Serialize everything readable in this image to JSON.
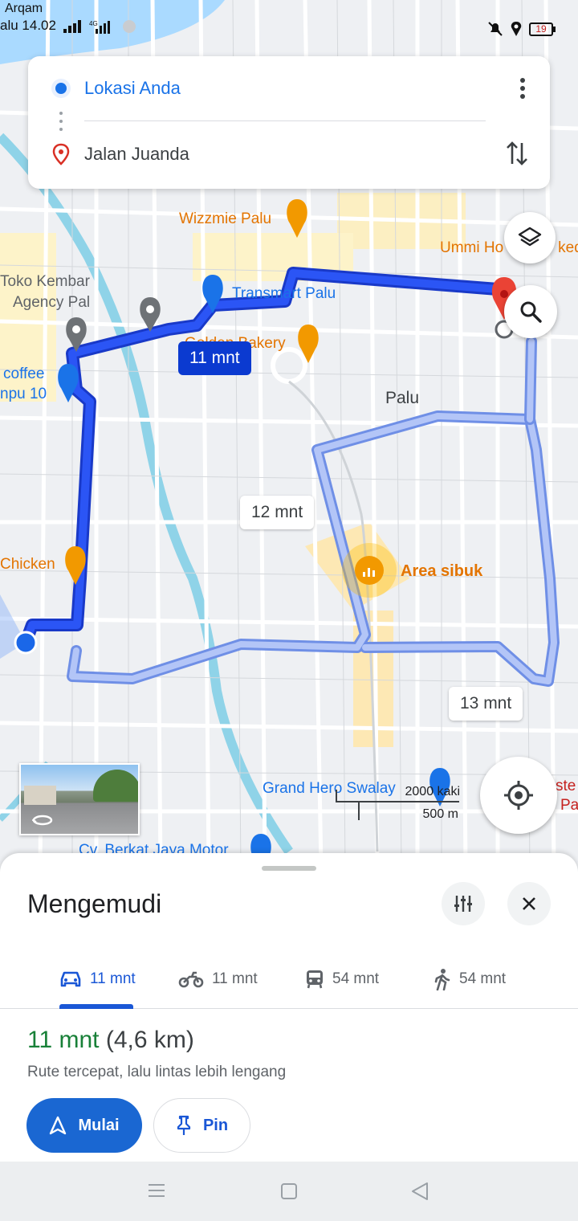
{
  "status_bar": {
    "carrier_top": "Arqam",
    "left_text": "alu 14.02",
    "battery": "19"
  },
  "directions": {
    "origin": "Lokasi Anda",
    "destination": "Jalan Juanda"
  },
  "map": {
    "labels": {
      "wizzmie": "Wizzmie Palu",
      "ummi": "Ummi Ho",
      "ummi_tail": "ked",
      "toko_kembar_1": "Toko Kembar",
      "toko_kembar_2": "Agency Pal",
      "transmart": "Transmart Palu",
      "golden_bakery": "Golden Bakery",
      "coffee": "coffee",
      "npu": "npu 10",
      "palu": "Palu",
      "chicken": "Chicken",
      "area_sibuk": "Area sibuk",
      "grand_hero": "Grand Hero Swalay",
      "berkat_jaya": "Cv. Berkat Jaya Motor",
      "right_red_1": "ste",
      "right_red_2": "Pa"
    },
    "route_times": {
      "main": "11 mnt",
      "alt1": "12 mnt",
      "alt2": "13 mnt"
    },
    "scale": {
      "imperial": "2000 kaki",
      "metric": "500 m"
    }
  },
  "sheet": {
    "title": "Mengemudi",
    "modes": [
      {
        "icon": "car-icon",
        "label": "11 mnt"
      },
      {
        "icon": "motorcycle-icon",
        "label": "11 mnt"
      },
      {
        "icon": "transit-icon",
        "label": "54 mnt"
      },
      {
        "icon": "walk-icon",
        "label": "54 mnt"
      }
    ],
    "summary_time": "11 mnt",
    "summary_distance": "(4,6 km)",
    "summary_sub": "Rute tercepat, lalu lintas lebih lengang",
    "start_label": "Mulai",
    "pin_label": "Pin"
  },
  "colors": {
    "route_main": "#1b3ff0",
    "route_alt": "#9db3f5",
    "accent": "#1a73e8",
    "green": "#188038"
  }
}
